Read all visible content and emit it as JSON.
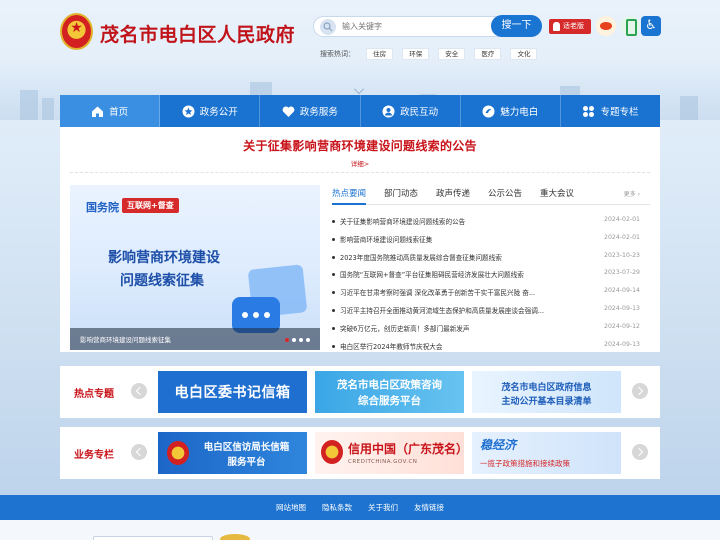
{
  "header": {
    "site_title": "茂名市电白区人民政府",
    "search": {
      "placeholder": "输入关键字",
      "button_label": "搜一下"
    },
    "elder_mode_label": "适老版",
    "hot_search": {
      "label": "搜索热词：",
      "tags": [
        "住房",
        "环保",
        "安全",
        "医疗",
        "文化"
      ]
    },
    "icons": [
      "weibo-icon",
      "mobile-icon",
      "accessibility-icon"
    ]
  },
  "nav": {
    "items": [
      {
        "label": "首页",
        "icon": "home-icon"
      },
      {
        "label": "政务公开",
        "icon": "star-icon"
      },
      {
        "label": "政务服务",
        "icon": "heart-icon"
      },
      {
        "label": "政民互动",
        "icon": "user-icon"
      },
      {
        "label": "魅力电白",
        "icon": "swirl-icon"
      },
      {
        "label": "专题专栏",
        "icon": "grid-icon"
      }
    ]
  },
  "headline": {
    "title": "关于征集影响营商环境建设问题线索的公告",
    "more": "详细>"
  },
  "banner": {
    "org": "国务院",
    "tag": "互联网+督查",
    "line1": "影响营商环境建设",
    "line2": "问题线索征集",
    "caption": "影响营商环境建设问题线索征集"
  },
  "news_tabs": {
    "tabs": [
      "热点要闻",
      "部门动态",
      "政声传递",
      "公示公告",
      "重大会议"
    ],
    "more": "更多 ›"
  },
  "news": [
    {
      "title": "关于征集影响营商环境建设问题线索的公告",
      "date": "2024-02-01"
    },
    {
      "title": "影响营商环境建设问题线索征集",
      "date": "2024-02-01"
    },
    {
      "title": "2023年度国务院推动高质量发展综合督查征集问题线索",
      "date": "2023-10-23"
    },
    {
      "title": "国务院“互联网+督查”平台征集阻碍民营经济发展壮大问题线索",
      "date": "2023-07-29"
    },
    {
      "title": "习近平在甘肃考察时强调 深化改革勇于创新苦干实干富民兴陇 奋...",
      "date": "2024-09-14"
    },
    {
      "title": "习近平主持召开全面推动黄河流域生态保护和高质量发展座谈会强调...",
      "date": "2024-09-13"
    },
    {
      "title": "突破6万亿元，创历史新高！多部门最新发声",
      "date": "2024-09-12"
    },
    {
      "title": "电白区举行2024年教师节庆祝大会",
      "date": "2024-09-13"
    }
  ],
  "hot_topics": {
    "label": "热点专题",
    "tiles": [
      {
        "line1": "电白区委书记信箱"
      },
      {
        "line1": "茂名市电白区政策咨询",
        "line2": "综合服务平台"
      },
      {
        "line1": "茂名市电白区政府信息",
        "line2": "主动公开基本目录清单"
      }
    ]
  },
  "business": {
    "label": "业务专栏",
    "tiles": [
      {
        "line1": "电白区信访局长信箱",
        "line2": "服务平台"
      },
      {
        "line1": "信用中国（广东茂名）",
        "line2": "CREDITCHINA.GOV.CN"
      },
      {
        "line1": "稳经济",
        "line2": "一揽子政策措施和接续政策"
      }
    ]
  },
  "footer": {
    "links": [
      "网站地图",
      "隐私条款",
      "关于我们",
      "友情链接"
    ]
  },
  "colors": {
    "primary_blue": "#1b73d1",
    "title_red": "#c8141a",
    "elder_red": "#d62a2a"
  }
}
